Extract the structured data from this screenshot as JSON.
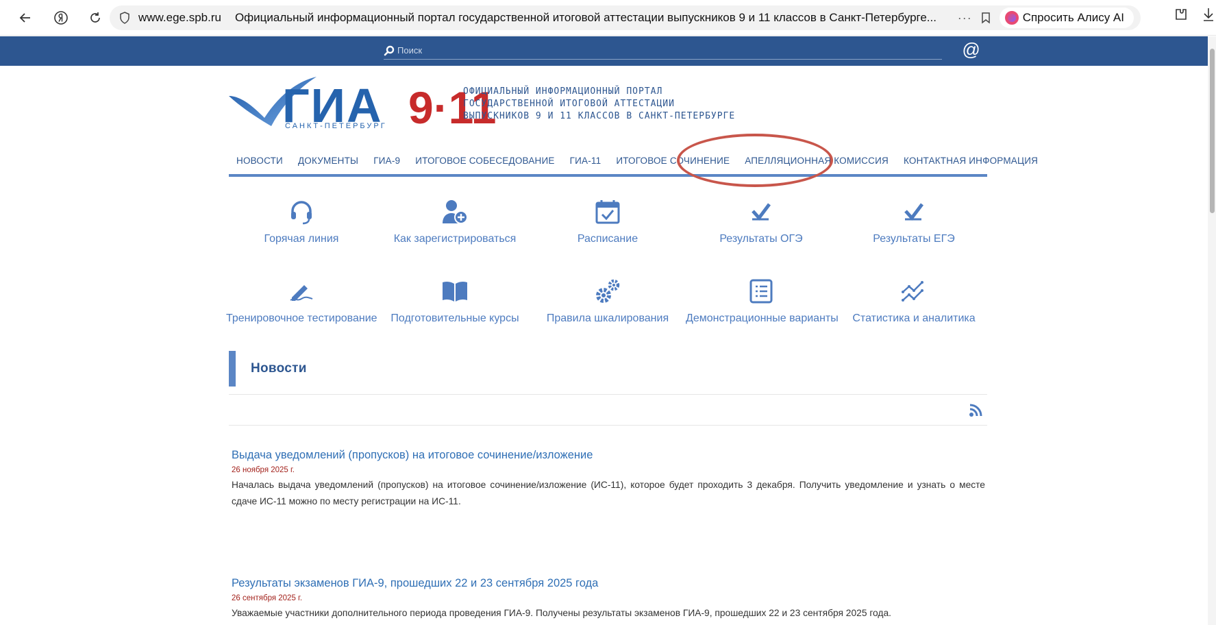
{
  "browser": {
    "url": "www.ege.spb.ru",
    "tab_title": "Официальный информационный портал государственной итоговой аттестации выпускников 9 и 11 классов в Санкт-Петербурге...",
    "alice_label": "Спросить Алису AI"
  },
  "site": {
    "search_placeholder": "Поиск",
    "logo": {
      "brand": "ГИА",
      "grades": "9·11",
      "city": "САНКТ-ПЕТЕРБУРГ",
      "line1": "ОФИЦИАЛЬНЫЙ ИНФОРМАЦИОННЫЙ ПОРТАЛ",
      "line2": "ГОСУДАРСТВЕННОЙ ИТОГОВОЙ АТТЕСТАЦИИ",
      "line3": "ВЫПУСКНИКОВ 9 И 11 КЛАССОВ В САНКТ-ПЕТЕРБУРГЕ"
    },
    "nav": [
      "НОВОСТИ",
      "ДОКУМЕНТЫ",
      "ГИА-9",
      "ИТОГОВОЕ СОБЕСЕДОВАНИЕ",
      "ГИА-11",
      "ИТОГОВОЕ СОЧИНЕНИЕ",
      "АПЕЛЛЯЦИОННАЯ КОМИССИЯ",
      "КОНТАКТНАЯ ИНФОРМАЦИЯ"
    ],
    "quick_links": [
      {
        "label": "Горячая линия",
        "icon": "headset-icon"
      },
      {
        "label": "Как зарегистрироваться",
        "icon": "user-add-icon"
      },
      {
        "label": "Расписание",
        "icon": "calendar-check-icon"
      },
      {
        "label": "Результаты ОГЭ",
        "icon": "checkmark-icon"
      },
      {
        "label": "Результаты ЕГЭ",
        "icon": "checkmark-icon"
      },
      {
        "label": "Тренировочное тестирование",
        "icon": "pen-writing-icon"
      },
      {
        "label": "Подготовительные курсы",
        "icon": "open-book-icon"
      },
      {
        "label": "Правила шкалирования",
        "icon": "gears-icon"
      },
      {
        "label": "Демонстрационные варианты",
        "icon": "list-document-icon"
      },
      {
        "label": "Статистика и аналитика",
        "icon": "trend-chart-icon"
      }
    ],
    "news_heading": "Новости",
    "news": [
      {
        "title": "Выдача уведомлений (пропусков) на итоговое сочинение/изложение",
        "date": "26 ноября 2025 г.",
        "text": "Началась выдача уведомлений (пропусков) на итоговое сочинение/изложение (ИС-11), которое будет проходить 3 декабря. Получить уведомление и узнать о месте сдаче ИС-11 можно по месту регистрации на ИС-11."
      },
      {
        "title": "Результаты экзаменов ГИА-9, прошедших 22 и 23 сентября 2025 года",
        "date": "26 сентября 2025 г.",
        "text": "Уважаемые участники дополнительного периода проведения ГИА-9. Получены результаты экзаменов ГИА-9, прошедших 22 и 23 сентября 2025 года."
      }
    ]
  },
  "colors": {
    "header_blue": "#2d5690",
    "accent_blue": "#5b86c5",
    "link_blue": "#4d7bbf",
    "date_red": "#a3231d",
    "annotation_red": "#c8564b"
  }
}
